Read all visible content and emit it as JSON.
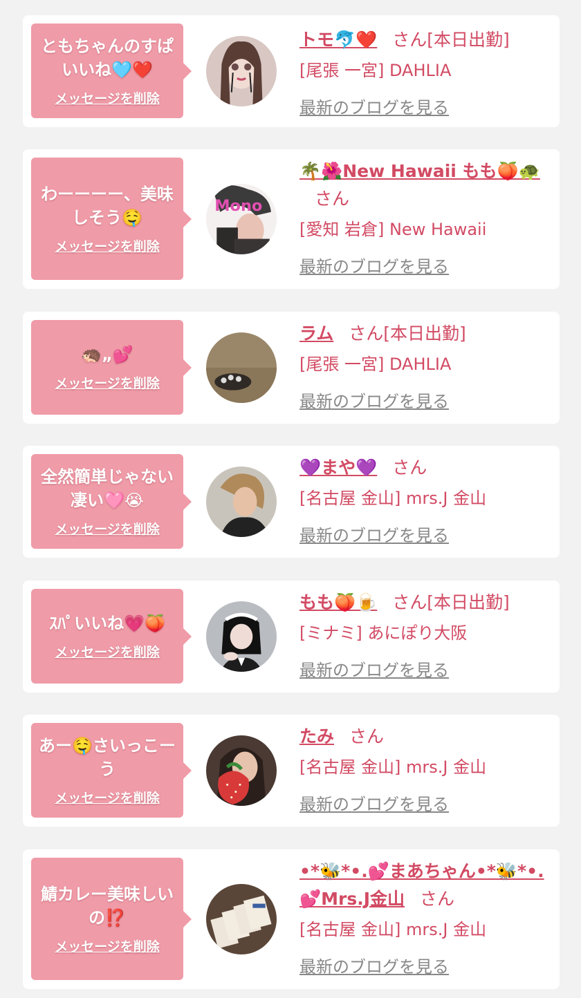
{
  "labels": {
    "delete_message": "メッセージを削除",
    "latest_blog": "最新のブログを見る"
  },
  "colors": {
    "page_background": "#f2f2f2",
    "card_background": "#ffffff",
    "bubble_background": "#f09ba8",
    "accent_text": "#d24a63",
    "link_gray": "#888888"
  },
  "messages": [
    {
      "text": "ともちゃんのすぱいいね🩵❤️",
      "name": "トモ🐬❤️",
      "suffix": "さん[本日出勤]",
      "shop": "[尾張 一宮] DAHLIA",
      "avatar_icon": "doll-portrait-avatar"
    },
    {
      "text": "わーーーー、美味しそう🤤",
      "name": "🌴🌺New Hawaii もも🍑🐢",
      "suffix": "さん",
      "shop": "[愛知 岩倉] New Hawaii",
      "avatar_icon": "selfie-avatar"
    },
    {
      "text": "🦔„💕",
      "name": "ラム",
      "suffix": "さん[本日出勤]",
      "shop": "[尾張 一宮] DAHLIA",
      "avatar_icon": "hair-photo-avatar"
    },
    {
      "text": "全然簡単じゃない凄い🩷😭",
      "name": "💜まや💜",
      "suffix": "さん",
      "shop": "[名古屋 金山] mrs.J 金山",
      "avatar_icon": "woman-photo-avatar"
    },
    {
      "text": "ｽﾊﾟいいね💗🍑",
      "name": "もも🍑🍺",
      "suffix": "さん[本日出勤]",
      "shop": "[ミナミ] あにぽり大阪",
      "avatar_icon": "maid-photo-avatar"
    },
    {
      "text": "あー🤤さいっこーう",
      "name": "たみ",
      "suffix": "さん",
      "shop": "[名古屋 金山] mrs.J 金山",
      "avatar_icon": "strawberry-photo-avatar"
    },
    {
      "text": "鯖カレー美味しいの⁉️",
      "name": "•*🐝*•.💕まあちゃん•*🐝*•.💕Mrs.J金山",
      "suffix": "さん",
      "shop": "[名古屋 金山] mrs.J 金山",
      "avatar_icon": "cards-photo-avatar"
    }
  ]
}
